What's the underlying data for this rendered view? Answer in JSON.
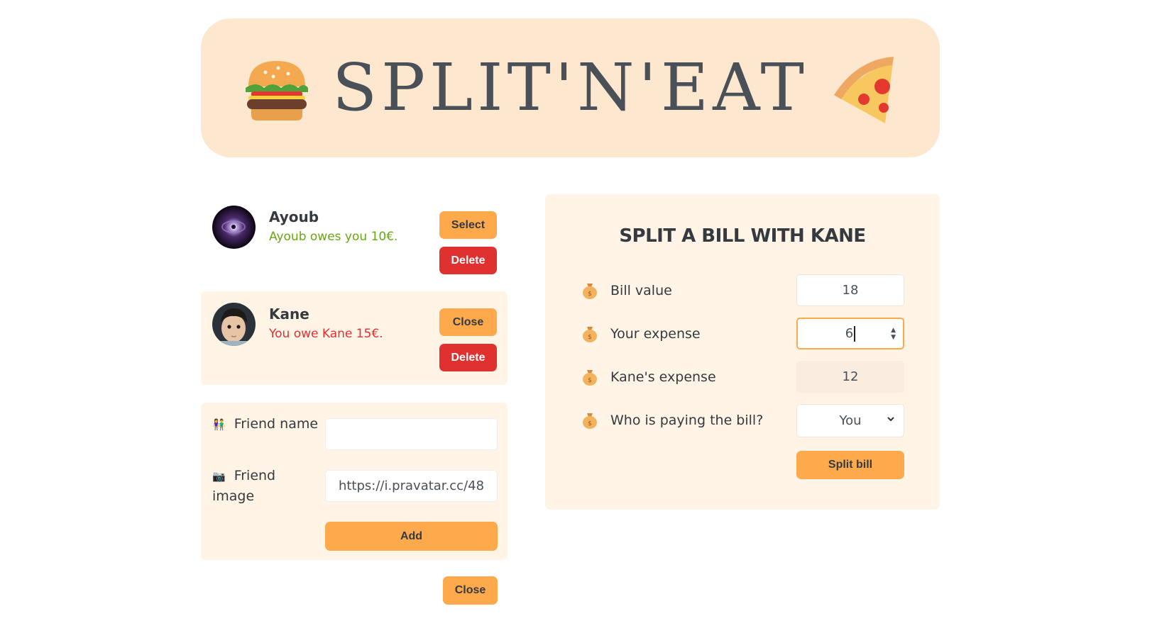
{
  "app": {
    "title": "SPLIT'N'EAT"
  },
  "friends": [
    {
      "name": "Ayoub",
      "balance": "Ayoub owes you 10€.",
      "action_label": "Select",
      "delete_label": "Delete"
    },
    {
      "name": "Kane",
      "balance": "You owe Kane 15€.",
      "action_label": "Close",
      "delete_label": "Delete"
    }
  ],
  "add_form": {
    "name_emoji": "👫",
    "name_label": "Friend name",
    "name_value": "",
    "image_emoji": "📷",
    "image_label": "Friend image",
    "image_value": "https://i.pravatar.cc/48",
    "submit_label": "Add"
  },
  "close_form_label": "Close",
  "split_form": {
    "title": "SPLIT A BILL WITH KANE",
    "bill_label": "Bill value",
    "bill_value": "18",
    "your_label": "Your expense",
    "your_value": "6",
    "friend_label": "Kane's expense",
    "friend_value": "12",
    "payer_label": "Who is paying the bill?",
    "payer_value": "You",
    "submit_label": "Split bill"
  },
  "colors": {
    "accent": "#ffa94d",
    "danger": "#e03131",
    "positive": "#66a80f",
    "panel": "#fff4e6",
    "header": "#fde8cf"
  }
}
